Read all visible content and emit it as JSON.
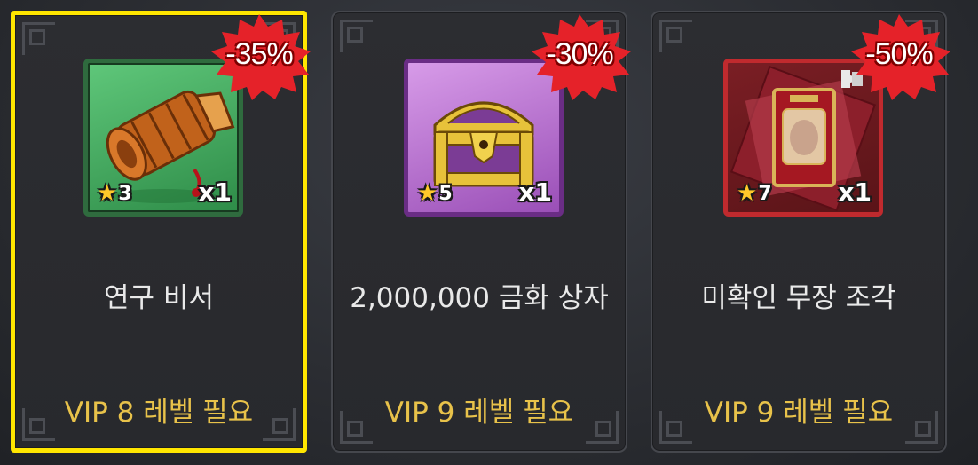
{
  "items": [
    {
      "name": "연구 비서",
      "discount": "-35%",
      "stars": "3",
      "quantity": "x1",
      "requirement": "VIP 8 레벨 필요",
      "icon": "scroll-icon",
      "rarity_color": "#3a9a55",
      "selected": true
    },
    {
      "name": "2,000,000 금화 상자",
      "discount": "-30%",
      "stars": "5",
      "quantity": "x1",
      "requirement": "VIP 9 레벨 필요",
      "icon": "treasure-chest-icon",
      "rarity_color": "#b86ad0",
      "selected": false
    },
    {
      "name": "미확인 무장 조각",
      "discount": "-50%",
      "stars": "7",
      "quantity": "x1",
      "requirement": "VIP 9 레벨 필요",
      "icon": "card-fragment-icon",
      "rarity_color": "#c02a2e",
      "selected": false
    }
  ],
  "colors": {
    "selection_border": "#ffe600",
    "requirement_text": "#e8c24a",
    "discount_badge": "#e52229"
  }
}
